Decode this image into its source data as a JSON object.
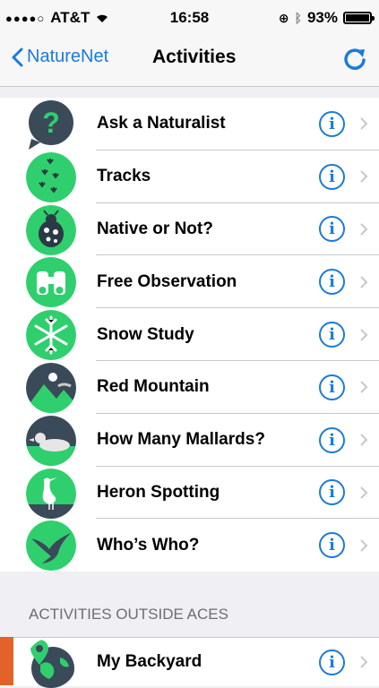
{
  "status": {
    "carrier": "AT&T",
    "time": "16:58",
    "battery": "93%",
    "battery_level": 0.93
  },
  "nav": {
    "back_label": "NatureNet",
    "title": "Activities"
  },
  "activities": [
    {
      "label": "Ask a Naturalist",
      "icon": "question-icon"
    },
    {
      "label": "Tracks",
      "icon": "tracks-icon"
    },
    {
      "label": "Native or Not?",
      "icon": "ladybug-icon"
    },
    {
      "label": "Free Observation",
      "icon": "binoculars-icon"
    },
    {
      "label": "Snow Study",
      "icon": "snowflake-icon"
    },
    {
      "label": "Red Mountain",
      "icon": "mountain-icon"
    },
    {
      "label": "How Many Mallards?",
      "icon": "duck-icon"
    },
    {
      "label": "Heron Spotting",
      "icon": "heron-icon"
    },
    {
      "label": "Who’s Who?",
      "icon": "bird-icon"
    }
  ],
  "outside_section": {
    "header": "ACTIVITIES OUTSIDE ACES",
    "items": [
      {
        "label": "My Backyard",
        "icon": "globe-pin-icon"
      }
    ]
  },
  "colors": {
    "accent": "#1a7bd9",
    "green": "#2fcf6e",
    "dark": "#3a4a58"
  }
}
